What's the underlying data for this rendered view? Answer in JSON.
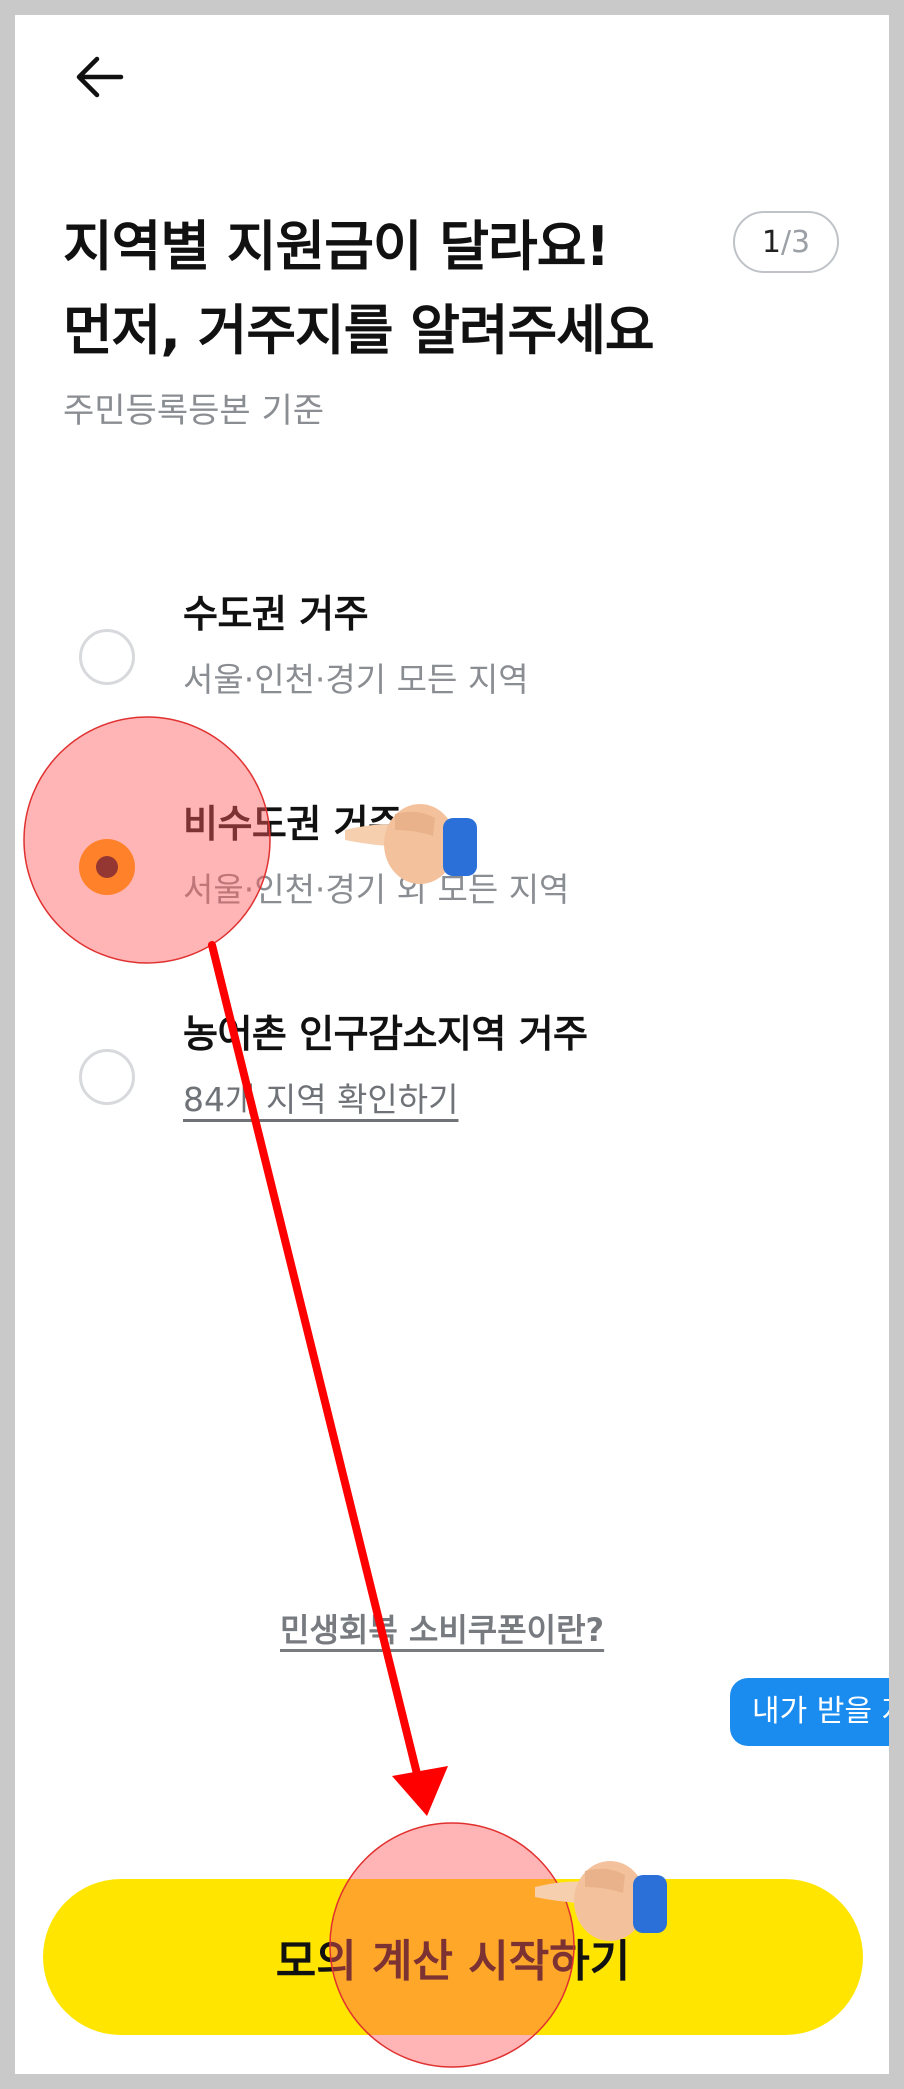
{
  "header": {
    "back_icon": "arrow-left-icon"
  },
  "title": {
    "line1": "지역별 지원금이 달라요!",
    "line2": "먼저, 거주지를 알려주세요"
  },
  "step": {
    "current": "1",
    "separator": "/",
    "total": "3"
  },
  "subtitle": "주민등록등본 기준",
  "options": [
    {
      "title": "수도권 거주",
      "sub": "서울·인천·경기 모든 지역",
      "selected": false
    },
    {
      "title": "비수도권 거주",
      "sub": "서울·인천·경기 외 모든 지역",
      "selected": true
    },
    {
      "title": "농어촌 인구감소지역 거주",
      "sub": "84개 지역 확인하기",
      "selected": false
    }
  ],
  "info_link": "민생회복 소비쿠폰이란?",
  "chat_bubble": "내가 받을 지",
  "cta": {
    "label": "모의 계산 시작하기"
  },
  "colors": {
    "cta": "#ffe500",
    "radio_selected": "#ffa000",
    "radio_dot": "#3c1a12",
    "bubble": "#1a8cf0",
    "annotation": "#ff0000"
  }
}
